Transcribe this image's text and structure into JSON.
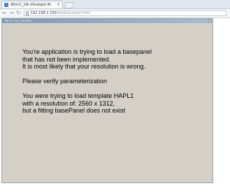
{
  "browser": {
    "tab_title": "WinCC_OA Ultralight W",
    "tab_close": "×",
    "url_host": "192.168.1.150",
    "url_path": "/data/ulc/start.html"
  },
  "app": {
    "window_title": "WinCC_OA_1 (#0/#0)"
  },
  "message": {
    "line1": "You're application is trying to load a basepanel",
    "line2": "that has not been implemented.",
    "line3": "It is most likely that your resolution is wrong.",
    "line4": "Please verify parameterization",
    "line5": "You were trying to load template HAPL1",
    "line6": "with a resolution of: 2560 x 1312,",
    "line7": "but a fitting basePanel does not exist"
  }
}
